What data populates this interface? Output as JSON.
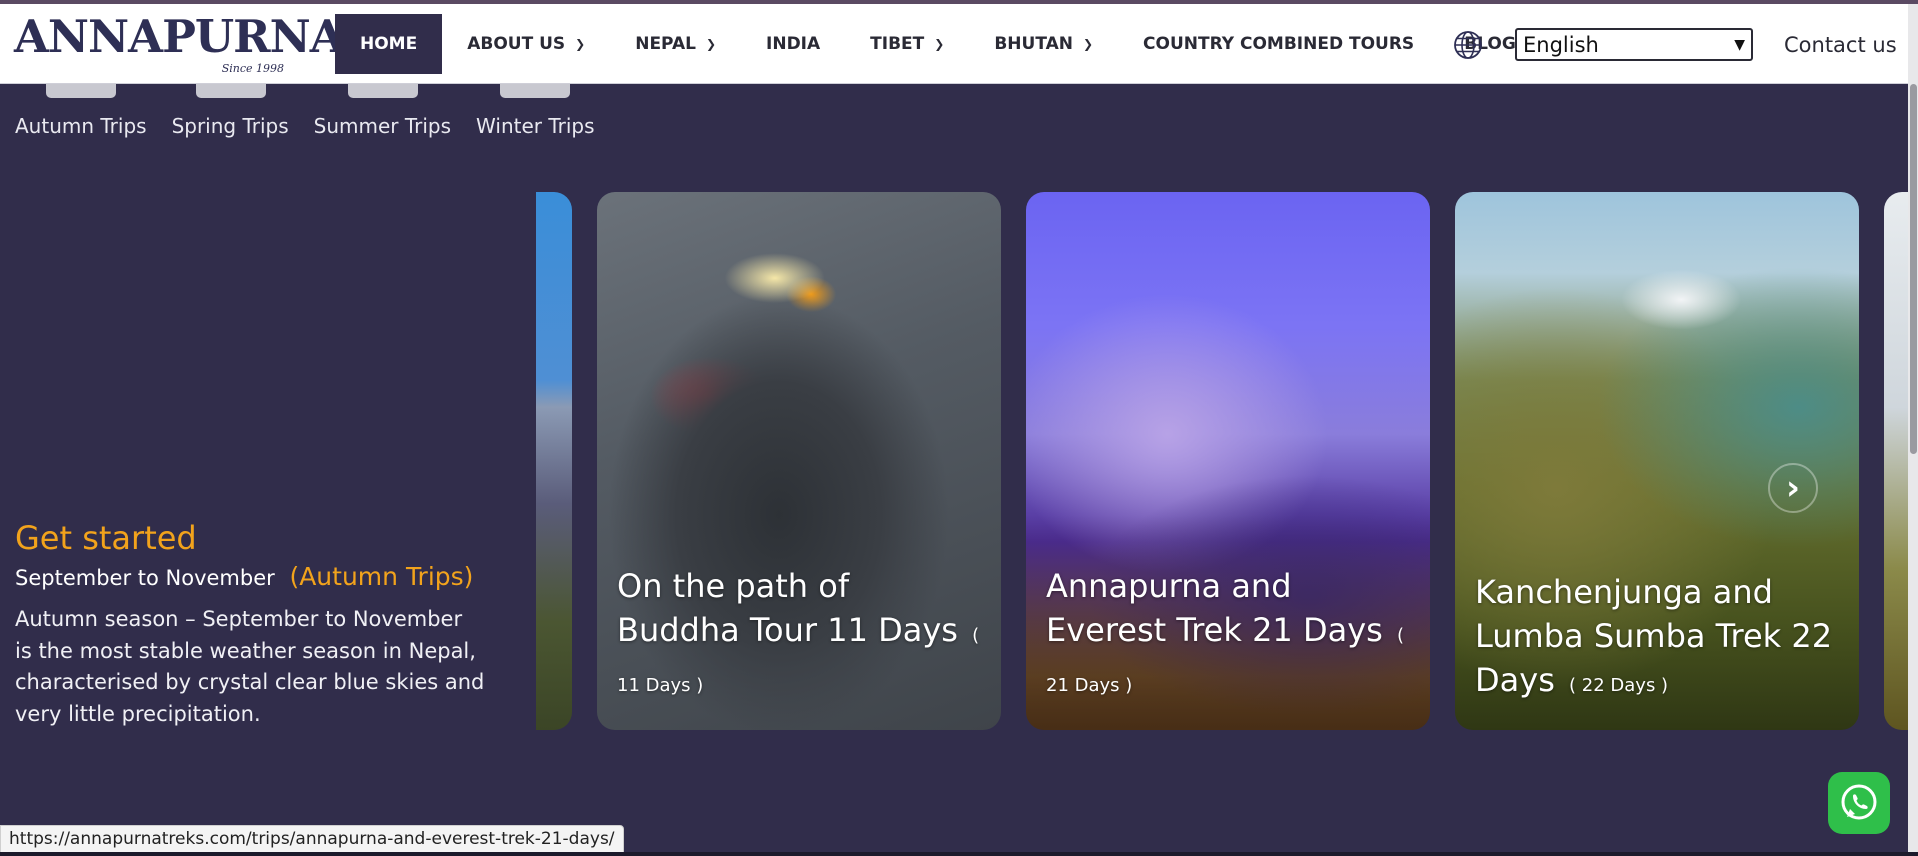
{
  "header": {
    "logo": {
      "text": "ANNAPURNA",
      "tagline": "Since 1998"
    },
    "nav": [
      {
        "label": "HOME",
        "has_dropdown": false,
        "active": true
      },
      {
        "label": "ABOUT US",
        "has_dropdown": true
      },
      {
        "label": "NEPAL",
        "has_dropdown": true
      },
      {
        "label": "INDIA",
        "has_dropdown": false
      },
      {
        "label": "TIBET",
        "has_dropdown": true
      },
      {
        "label": "BHUTAN",
        "has_dropdown": true
      },
      {
        "label": "COUNTRY COMBINED TOURS",
        "has_dropdown": false
      },
      {
        "label": "BLOG",
        "has_dropdown": false
      }
    ],
    "globe_icon": "globe-icon",
    "language": {
      "selected": "English"
    },
    "contact_label": "Contact us"
  },
  "seasons": {
    "tabs": [
      "Autumn Trips",
      "Spring Trips",
      "Summer Trips",
      "Winter Trips"
    ]
  },
  "intro": {
    "heading": "Get started",
    "range": "September to November",
    "season_label": "(Autumn Trips)",
    "description": "Autumn season – September to November is the most stable weather season in Nepal, characterised by crystal clear blue skies and very little precipitation."
  },
  "trips": [
    {
      "title": "On the path of Buddha Tour 11 Days",
      "days": "( 11 Days )"
    },
    {
      "title": "Annapurna and Everest Trek 21 Days",
      "days": "( 21 Days )"
    },
    {
      "title": "Kanchenjunga and Lumba Sumba Trek 22 Days",
      "days": "( 22 Days )"
    }
  ],
  "carousel": {
    "next_icon": "chevron-right-icon"
  },
  "status_bar": {
    "url": "https://annapurnatreks.com/trips/annapurna-and-everest-trek-21-days/"
  },
  "colors": {
    "background": "#312d4b",
    "accent": "#f2a31c",
    "nav_active": "#312d4b",
    "whatsapp": "#2fbf4a"
  },
  "whatsapp": {
    "icon": "whatsapp-icon"
  }
}
